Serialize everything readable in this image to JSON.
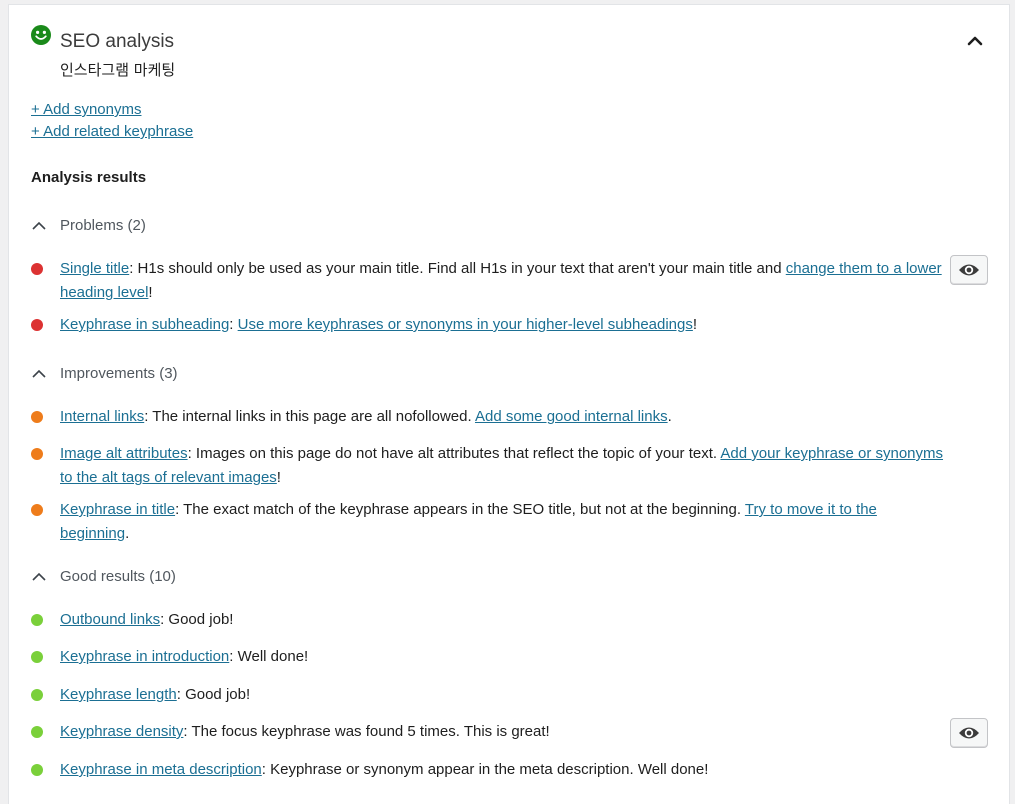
{
  "header": {
    "title": "SEO analysis",
    "keyphrase": "인스타그램 마케팅",
    "status_color": "#1a8a1a"
  },
  "links": {
    "add_synonyms": "+ Add synonyms",
    "add_related": "+ Add related keyphrase"
  },
  "analysis_heading": "Analysis results",
  "colors": {
    "red": "#dc3232",
    "orange": "#ee7c1b",
    "green": "#7ad03a",
    "link": "#1b6f93"
  },
  "groups": {
    "problems": {
      "label": "Problems (2)",
      "items": [
        {
          "link": "Single title",
          "text": ": H1s should only be used as your main title. Find all H1s in your text that aren't your main title and ",
          "link2": "change them to a lower heading level",
          "tail": "!"
        },
        {
          "link": "Keyphrase in subheading",
          "text": ": ",
          "link2": "Use more keyphrases or synonyms in your higher-level subheadings",
          "tail": "!"
        }
      ]
    },
    "improvements": {
      "label": "Improvements (3)",
      "items": [
        {
          "link": "Internal links",
          "text": ": The internal links in this page are all nofollowed. ",
          "link2": "Add some good internal links",
          "tail": "."
        },
        {
          "link": "Image alt attributes",
          "text": ": Images on this page do not have alt attributes that reflect the topic of your text. ",
          "link2": "Add your keyphrase or synonyms to the alt tags of relevant images",
          "tail": "!"
        },
        {
          "link": "Keyphrase in title",
          "text": ": The exact match of the keyphrase appears in the SEO title, but not at the beginning. ",
          "link2": "Try to move it to the beginning",
          "tail": "."
        }
      ]
    },
    "good": {
      "label": "Good results (10)",
      "items": [
        {
          "link": "Outbound links",
          "text": ": Good job!"
        },
        {
          "link": "Keyphrase in introduction",
          "text": ": Well done!"
        },
        {
          "link": "Keyphrase length",
          "text": ": Good job!"
        },
        {
          "link": "Keyphrase density",
          "text": ": The focus keyphrase was found 5 times. This is great!"
        },
        {
          "link": "Keyphrase in meta description",
          "text": ": Keyphrase or synonym appear in the meta description. Well done!"
        }
      ]
    }
  }
}
